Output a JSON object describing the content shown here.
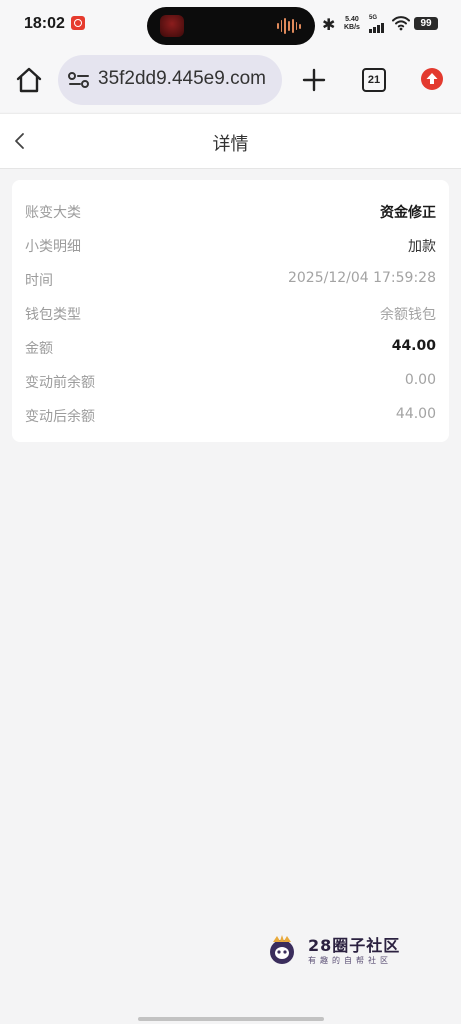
{
  "status_bar": {
    "time": "18:02",
    "net_speed_value": "5.40",
    "net_speed_unit": "KB/s",
    "network_type": "5G",
    "battery": "99"
  },
  "browser": {
    "url": "35f2dd9.445e9.com",
    "tab_count": "21"
  },
  "page": {
    "title": "详情",
    "details": [
      {
        "label": "账变大类",
        "value": "资金修正",
        "style": "strong"
      },
      {
        "label": "小类明细",
        "value": "加款",
        "style": "dark"
      },
      {
        "label": "时间",
        "value": "2025/12/04 17:59:28",
        "style": "muted"
      },
      {
        "label": "钱包类型",
        "value": "余额钱包",
        "style": "muted"
      },
      {
        "label": "金额",
        "value": "44.00",
        "style": "strong"
      },
      {
        "label": "变动前余额",
        "value": "0.00",
        "style": "muted"
      },
      {
        "label": "变动后余额",
        "value": "44.00",
        "style": "muted"
      }
    ]
  },
  "watermark": {
    "title": "28圈子社区",
    "subtitle": "有趣的自帮社区"
  },
  "colors": {
    "accent_red": "#e33a2f",
    "card_bg": "#ffffff",
    "page_bg": "#f4f4f5"
  }
}
